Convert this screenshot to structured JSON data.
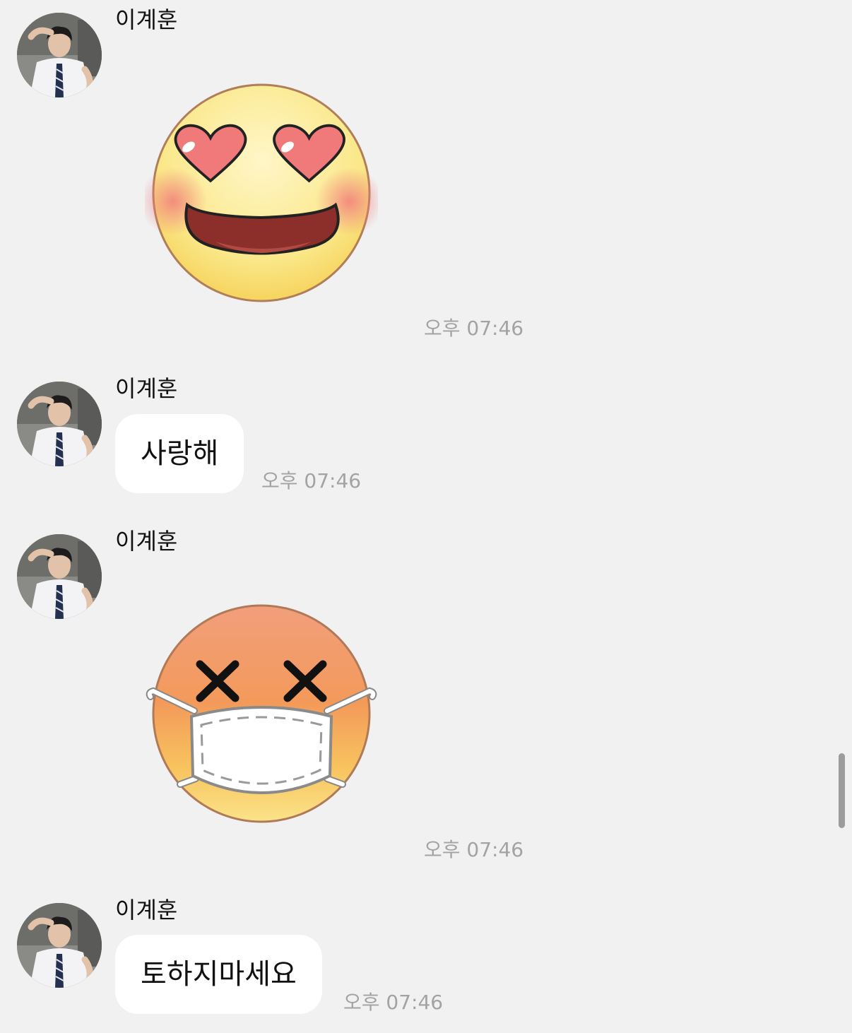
{
  "messages": [
    {
      "sender": "이계훈",
      "type": "sticker",
      "sticker_icon": "heart-eyes-smile-icon",
      "time": "오후 07:46"
    },
    {
      "sender": "이계훈",
      "type": "text",
      "text": "사랑해",
      "time": "오후 07:46"
    },
    {
      "sender": "이계훈",
      "type": "sticker",
      "sticker_icon": "dizzy-mask-face-icon",
      "time": "오후 07:46"
    },
    {
      "sender": "이계훈",
      "type": "text",
      "text": "토하지마세요",
      "time": "오후 07:46"
    }
  ],
  "colors": {
    "background": "#f1f1f1",
    "bubble": "#ffffff",
    "timestamp": "#a3a3a3"
  }
}
